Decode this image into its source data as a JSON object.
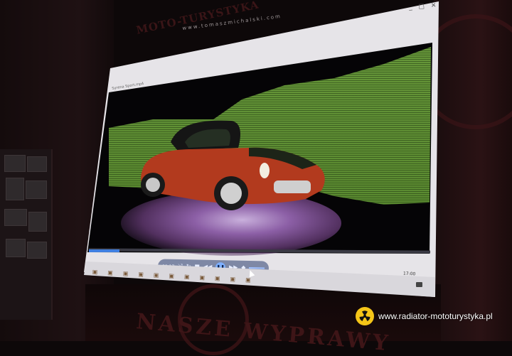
{
  "photo": {
    "watermark_top": "www.tomaszmichalski.com",
    "site_url": "www.radiator-mototurystyka.pl",
    "wall_slogan": "NASZE WYPRAWY",
    "screen_banner_fragment": "MOTO-TURYSTYKA",
    "emblem_icon": "radiation-trefoil-icon"
  },
  "player": {
    "window_title": "Syrena Sport.mp4",
    "window_controls": [
      "_",
      "□",
      "✕"
    ],
    "time_elapsed": "00:17",
    "seek_progress": 0.09,
    "accent_color": "#3f7fe0"
  },
  "taskbar": {
    "clock": "17:00"
  },
  "scene": {
    "car_color": "#b23a1e",
    "backdrop_color": "#6a9a3c",
    "floor_light_color": "#8c5fa6"
  }
}
